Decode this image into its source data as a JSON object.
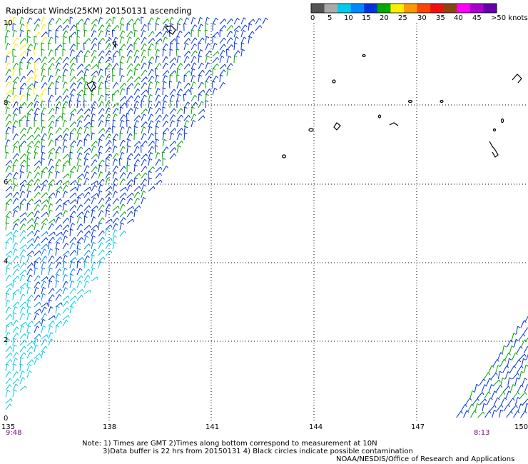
{
  "title": "Rapidscat Winds(25KM) 20150131 ascending",
  "legend": {
    "colors": [
      "#555555",
      "#aaaaaa",
      "#00ccee",
      "#0088ff",
      "#0033dd",
      "#00aa00",
      "#ffee00",
      "#ff9900",
      "#ff4400",
      "#ee1111",
      "#8b4513",
      "#ff00ff",
      "#aa00cc",
      "#6600aa"
    ],
    "labels": [
      "0",
      "5",
      "10",
      "15",
      "20",
      "25",
      "30",
      "35",
      "40",
      "45",
      ">50 knots"
    ]
  },
  "lat_labels": [
    "10",
    "8",
    "6",
    "4",
    "2",
    "0"
  ],
  "lon_labels": [
    "135",
    "138",
    "141",
    "144",
    "147",
    "150"
  ],
  "time_labels": [
    "9:48",
    "8:13"
  ],
  "notes": {
    "line1": "Note: 1) Times are GMT 2)Times along bottom correspond to measurement at 10N",
    "line2": "3)Data buffer is 22 hrs from 20150131 4) Black circles indicate possible contamination",
    "line3": "NOAA/NESDIS/Office of Research and Applications"
  },
  "wind_colors": {
    "weak_yellow": "#ffee00",
    "light_green": "#00aa00",
    "blue": "#0033dd",
    "mid_blue": "#0088ff",
    "cyan": "#00ccee"
  }
}
